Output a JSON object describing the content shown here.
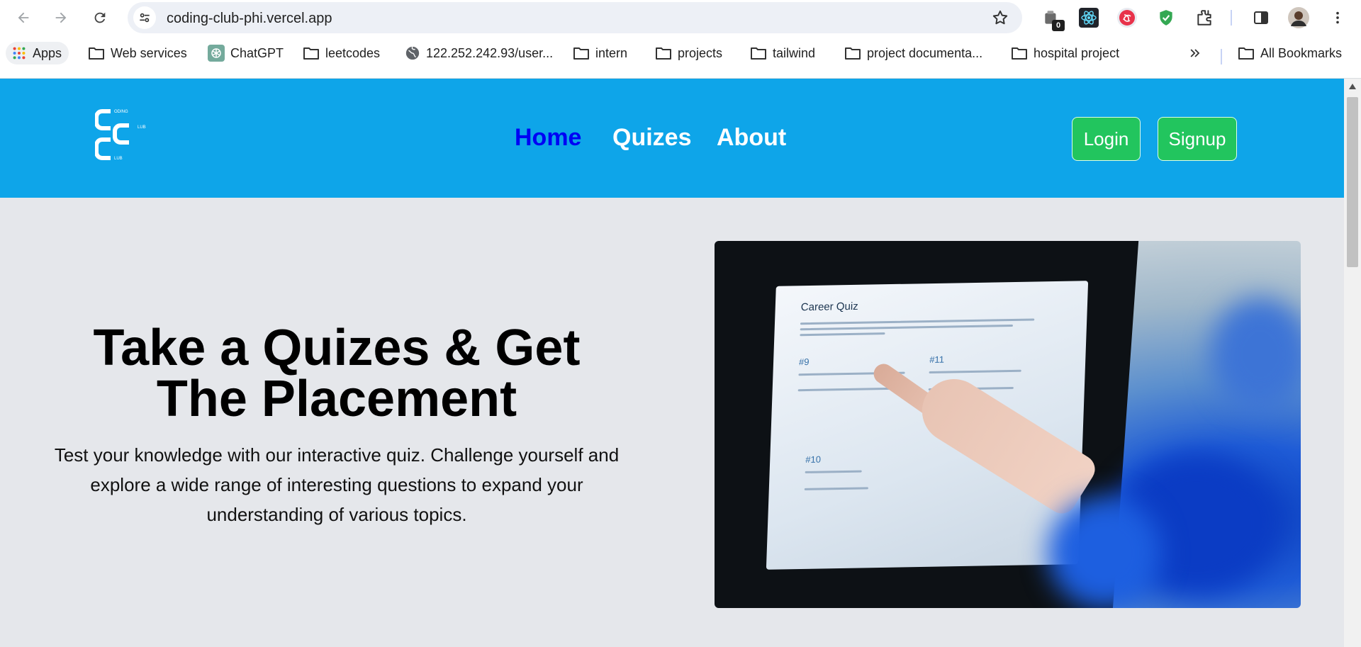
{
  "browser": {
    "url": "coding-club-phi.vercel.app",
    "extensions": [
      {
        "name": "toolbox-extension-icon",
        "badge": "0"
      },
      {
        "name": "react-devtools-icon"
      },
      {
        "name": "redux-devtools-icon"
      },
      {
        "name": "shield-extension-icon"
      },
      {
        "name": "puzzle-extensions-icon"
      }
    ]
  },
  "bookmarks": {
    "items": [
      {
        "label": "Apps",
        "icon": "apps-grid-icon"
      },
      {
        "label": "Web services",
        "icon": "folder-icon"
      },
      {
        "label": "ChatGPT",
        "icon": "chatgpt-icon"
      },
      {
        "label": "leetcodes",
        "icon": "folder-icon"
      },
      {
        "label": "122.252.242.93/user...",
        "icon": "globe-icon"
      },
      {
        "label": "intern",
        "icon": "folder-icon"
      },
      {
        "label": "projects",
        "icon": "folder-icon"
      },
      {
        "label": "tailwind",
        "icon": "folder-icon"
      },
      {
        "label": "project documenta...",
        "icon": "folder-icon"
      },
      {
        "label": "hospital project",
        "icon": "folder-icon"
      }
    ],
    "all_bookmarks": "All Bookmarks"
  },
  "site": {
    "nav": {
      "home": "Home",
      "quizes": "Quizes",
      "about": "About"
    },
    "login": "Login",
    "signup": "Signup",
    "logo_text": {
      "top": "ODING",
      "right": "LUB",
      "bottom": "LUB"
    }
  },
  "hero": {
    "title_line1": "Take a Quizes & Get",
    "title_line2": "The Placement",
    "text": "Test your knowledge with our interactive quiz. Challenge yourself and explore a wide range of interesting questions to expand your understanding of various topics.",
    "image": {
      "quiz_title": "Career Quiz",
      "q1": "#9",
      "q2": "#11",
      "q3": "#10"
    }
  },
  "colors": {
    "header_bg": "#0ea5e9",
    "nav_active": "#0000f5",
    "button_bg": "#22c55e",
    "page_bg": "#e5e7eb"
  }
}
